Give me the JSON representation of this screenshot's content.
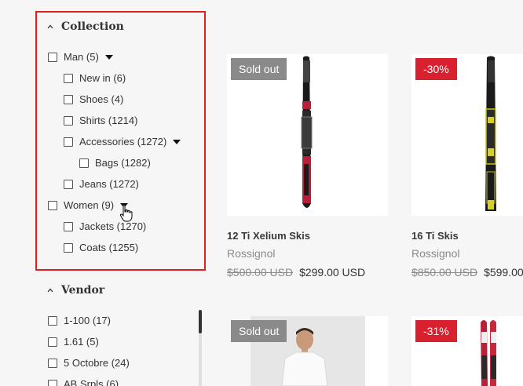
{
  "filters": {
    "collection": {
      "title": "Collection",
      "items": [
        {
          "label": "Man (5)"
        },
        {
          "label": "New in (6)"
        },
        {
          "label": "Shoes (4)"
        },
        {
          "label": "Shirts (1214)"
        },
        {
          "label": "Accessories (1272)"
        },
        {
          "label": "Bags (1282)"
        },
        {
          "label": "Jeans (1272)"
        },
        {
          "label": "Women (9)"
        },
        {
          "label": "Jackets (1270)"
        },
        {
          "label": "Coats (1255)"
        }
      ]
    },
    "vendor": {
      "title": "Vendor",
      "items": [
        {
          "label": "1-100 (17)"
        },
        {
          "label": "1.61 (5)"
        },
        {
          "label": "5 Octobre (24)"
        },
        {
          "label": "AB Srpls (6)"
        }
      ]
    }
  },
  "products": [
    {
      "badge": "Sold out",
      "badge_type": "sold",
      "name": "12 Ti Xelium Skis",
      "vendor": "Rossignol",
      "old_price": "$500.00 USD",
      "price": "$299.00 USD"
    },
    {
      "badge": "-30%",
      "badge_type": "sale",
      "name": "16 Ti Skis",
      "vendor": "Rossignol",
      "old_price": "$850.00 USD",
      "price": "$599.00"
    },
    {
      "badge": "Sold out",
      "badge_type": "sold"
    },
    {
      "badge": "-31%",
      "badge_type": "sale"
    }
  ],
  "colors": {
    "highlight": "#e02020",
    "sale_badge": "#d8202e",
    "sold_badge": "#8a8a8a"
  }
}
